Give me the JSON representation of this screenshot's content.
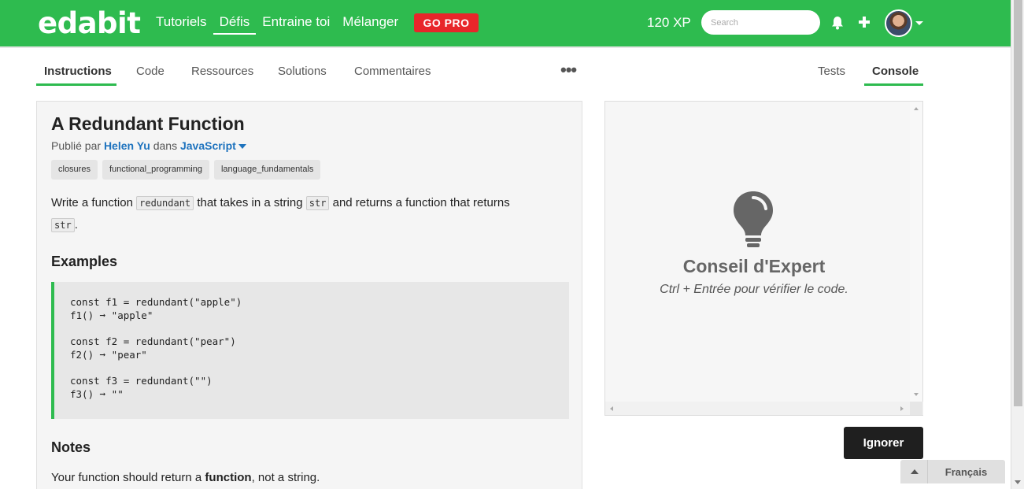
{
  "topnav": {
    "logo": "edabit",
    "links": [
      "Tutoriels",
      "Défis",
      "Entraine toi",
      "Mélanger"
    ],
    "gopro": "GO PRO",
    "xp": "120 XP",
    "search_placeholder": "Search"
  },
  "tabs": {
    "left": [
      "Instructions",
      "Code",
      "Ressources",
      "Solutions",
      "Commentaires"
    ],
    "right": [
      "Tests",
      "Console"
    ],
    "more": "•••"
  },
  "challenge": {
    "title": "A Redundant Function",
    "published_by": "Publié par",
    "author": "Helen Yu",
    "in": "dans",
    "language": "JavaScript",
    "tags": [
      "closures",
      "functional_programming",
      "language_fundamentals"
    ],
    "desc_1": "Write a function",
    "desc_code_1": "redundant",
    "desc_2": "that takes in a string",
    "desc_code_2": "str",
    "desc_3": "and returns a function that returns",
    "desc_code_3": "str",
    "desc_4": ".",
    "examples_heading": "Examples",
    "code_lines": [
      "const f1 = redundant(\"apple\")",
      "f1() ➞ \"apple\"",
      "",
      "const f2 = redundant(\"pear\")",
      "f2() ➞ \"pear\"",
      "",
      "const f3 = redundant(\"\")",
      "f3() ➞ \"\""
    ],
    "notes_heading": "Notes",
    "notes_1": "Your function should return a",
    "notes_bold": "function",
    "notes_2": ", not a string."
  },
  "console": {
    "tip_title": "Conseil d'Expert",
    "tip_sub": "Ctrl + Entrée pour vérifier le code.",
    "ignore": "Ignorer"
  },
  "language_selector": "Français",
  "colors": {
    "brand": "#2ebb4f",
    "gopro": "#e8262a",
    "link": "#1e73be"
  }
}
